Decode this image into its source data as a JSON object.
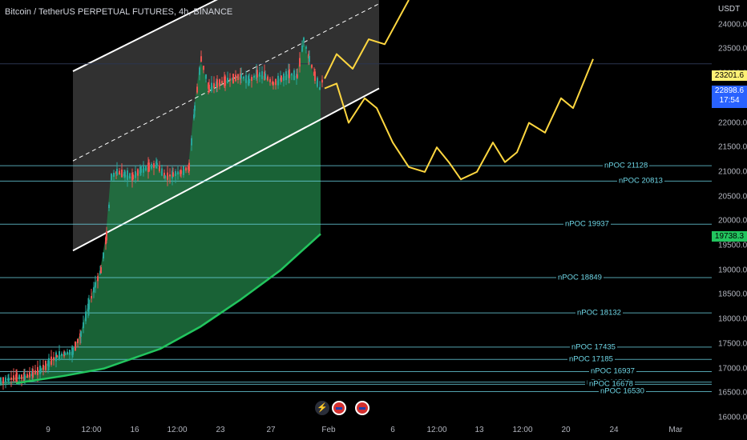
{
  "header": {
    "title": "Bitcoin / TetherUS PERPETUAL FUTURES, 4h, BINANCE"
  },
  "price_axis": {
    "unit": "USDT",
    "ticks": [
      "24000.0",
      "23500.0",
      "23000.0",
      "22500.0",
      "22000.0",
      "21500.0",
      "21000.0",
      "20500.0",
      "20000.0",
      "19500.0",
      "19000.0",
      "18500.0",
      "18000.0",
      "17500.0",
      "17000.0",
      "16500.0",
      "16000.0"
    ],
    "labels": {
      "level_price": "23201.6",
      "last_price": "22898.6",
      "countdown": "17:54",
      "green_price": "19738.3"
    }
  },
  "time_axis": {
    "ticks": [
      "9",
      "12:00",
      "16",
      "12:00",
      "23",
      "27",
      "Feb",
      "6",
      "12:00",
      "13",
      "12:00",
      "20",
      "24",
      "Mar"
    ]
  },
  "poc_lines": [
    {
      "label": "nPOC 21128",
      "price": 21128
    },
    {
      "label": "nPOC 20813",
      "price": 20813
    },
    {
      "label": "nPOC 19937",
      "price": 19937
    },
    {
      "label": "nPOC 18849",
      "price": 18849
    },
    {
      "label": "nPOC 18132",
      "price": 18132
    },
    {
      "label": "nPOC 17435",
      "price": 17435
    },
    {
      "label": "nPOC 17185",
      "price": 17185
    },
    {
      "label": "nPOC 16937",
      "price": 16937
    },
    {
      "label": "nPOC 16723",
      "price": 16723
    },
    {
      "label": "nPOC 16678",
      "price": 16678
    },
    {
      "label": "nPOC 16530",
      "price": 16530
    }
  ],
  "bottom_icons": [
    "bolt-icon",
    "us-flag-icon",
    "us-flag-icon"
  ],
  "colors": {
    "background": "#000000",
    "channel_fill": "#3a3a3a",
    "channel_line": "#ffffff",
    "volume_fill": "#1f7a43",
    "ema_line": "#22c55e",
    "projection": "#ffd740",
    "poc_line": "#6fd8e8",
    "candle_up": "#26a69a",
    "candle_down": "#ef5350"
  },
  "chart_data": {
    "type": "candlestick",
    "symbol": "Bitcoin / TetherUS PERPETUAL FUTURES",
    "interval": "4h",
    "ylim": [
      16000,
      24500
    ],
    "close_path": [
      [
        0,
        16750
      ],
      [
        10,
        16780
      ],
      [
        20,
        16820
      ],
      [
        30,
        16830
      ],
      [
        40,
        16900
      ],
      [
        50,
        16980
      ],
      [
        60,
        17120
      ],
      [
        70,
        17250
      ],
      [
        80,
        17300
      ],
      [
        90,
        17350
      ],
      [
        100,
        17700
      ],
      [
        110,
        18300
      ],
      [
        118,
        18700
      ],
      [
        125,
        19000
      ],
      [
        132,
        19700
      ],
      [
        138,
        20900
      ],
      [
        145,
        21000
      ],
      [
        155,
        20950
      ],
      [
        165,
        20900
      ],
      [
        175,
        21050
      ],
      [
        185,
        21100
      ],
      [
        195,
        21150
      ],
      [
        205,
        20900
      ],
      [
        215,
        20950
      ],
      [
        225,
        21000
      ],
      [
        235,
        21100
      ],
      [
        242,
        22300
      ],
      [
        250,
        23300
      ],
      [
        260,
        22700
      ],
      [
        270,
        22800
      ],
      [
        280,
        22850
      ],
      [
        290,
        22900
      ],
      [
        300,
        22950
      ],
      [
        310,
        22850
      ],
      [
        320,
        23000
      ],
      [
        330,
        22950
      ],
      [
        340,
        22800
      ],
      [
        350,
        22900
      ],
      [
        360,
        23000
      ],
      [
        370,
        22950
      ],
      [
        378,
        23700
      ],
      [
        385,
        23300
      ],
      [
        392,
        22950
      ],
      [
        398,
        22700
      ],
      [
        402,
        22898.6
      ]
    ],
    "channel": {
      "upper_start": [
        91,
        23050
      ],
      "upper_end": [
        473,
        26150
      ],
      "lower_start": [
        91,
        19400
      ],
      "lower_end": [
        473,
        22700
      ]
    },
    "projection_upper": [
      [
        405,
        22900
      ],
      [
        420,
        23400
      ],
      [
        440,
        23100
      ],
      [
        460,
        23700
      ],
      [
        480,
        23600
      ],
      [
        500,
        24200
      ],
      [
        510,
        24500
      ]
    ],
    "projection_lower": [
      [
        405,
        22700
      ],
      [
        420,
        22800
      ],
      [
        435,
        22000
      ],
      [
        455,
        22500
      ],
      [
        470,
        22300
      ],
      [
        490,
        21600
      ],
      [
        510,
        21100
      ],
      [
        530,
        21000
      ],
      [
        545,
        21500
      ],
      [
        560,
        21200
      ],
      [
        575,
        20850
      ],
      [
        595,
        21000
      ],
      [
        615,
        21600
      ],
      [
        630,
        21200
      ],
      [
        645,
        21400
      ],
      [
        660,
        22000
      ],
      [
        680,
        21800
      ],
      [
        700,
        22500
      ],
      [
        715,
        22300
      ],
      [
        740,
        23300
      ]
    ],
    "ema": [
      [
        20,
        16700
      ],
      [
        80,
        16850
      ],
      [
        130,
        17000
      ],
      [
        200,
        17400
      ],
      [
        250,
        17850
      ],
      [
        300,
        18400
      ],
      [
        350,
        19000
      ],
      [
        400,
        19738.3
      ]
    ]
  }
}
